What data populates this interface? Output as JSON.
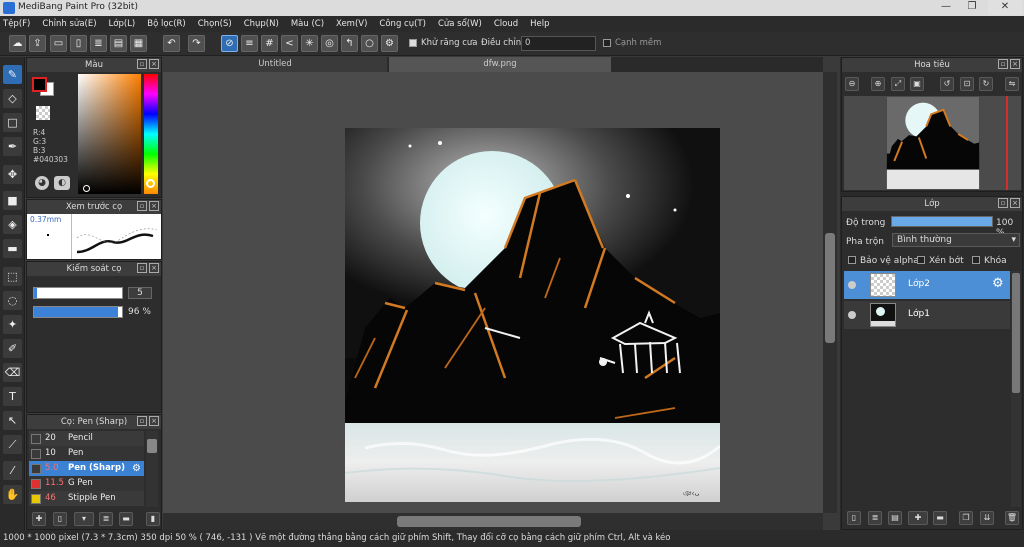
{
  "app": {
    "title": "MediBang Paint Pro (32bit)"
  },
  "menu": [
    "Tệp(F)",
    "Chỉnh sửa(E)",
    "Lớp(L)",
    "Bộ lọc(R)",
    "Chọn(S)",
    "Chụp(N)",
    "Màu (C)",
    "Xem(V)",
    "Công cụ(T)",
    "Cửa sổ(W)",
    "Cloud",
    "Help"
  ],
  "toolbar": {
    "antialias_label": "Khử răng cưa",
    "adjust_label": "Điều chỉnh",
    "adjust_value": "0",
    "snap_label": "Cạnh mềm"
  },
  "color_panel": {
    "title": "Màu",
    "r": "R:4",
    "g": "G:3",
    "b": "B:3",
    "hex": "#040303",
    "colors": {
      "primary": "#040303",
      "secondary": "#ffffff",
      "accent": "#2f6db5"
    }
  },
  "preview_panel": {
    "title": "Xem trước cọ",
    "size": "0.37mm"
  },
  "control_panel": {
    "title": "Kiểm soát cọ",
    "size_value": "5",
    "opacity_value": "96 %",
    "opacity_fraction": 0.96
  },
  "brush_panel": {
    "title": "Cọ: Pen (Sharp)",
    "items": [
      {
        "size": "20",
        "name": "Pencil",
        "color": "#3a3a3a",
        "selected": false
      },
      {
        "size": "10",
        "name": "Pen",
        "color": "#3a3a3a",
        "selected": false
      },
      {
        "size": "5.0",
        "name": "Pen (Sharp)",
        "color": "#3a3a3a",
        "selected": true
      },
      {
        "size": "11.5",
        "name": "G Pen",
        "color": "#e03030",
        "selected": false
      },
      {
        "size": "46",
        "name": "Stipple Pen",
        "color": "#e8c800",
        "selected": false
      }
    ]
  },
  "tabs": [
    {
      "label": "Untitled"
    },
    {
      "label": "dfw.png"
    }
  ],
  "navigator_panel": {
    "title": "Hoa tiêu"
  },
  "layers_panel": {
    "title": "Lớp",
    "opacity_label": "Độ trong",
    "opacity_value": "100 %",
    "opacity_fraction": 1.0,
    "blend_label": "Pha trộn",
    "blend_value": "Bình thường",
    "protect_alpha": "Bảo vệ alpha",
    "clipping": "Xén bớt",
    "lock": "Khóa",
    "layers": [
      {
        "name": "Lớp2",
        "selected": true
      },
      {
        "name": "Lớp1",
        "selected": false
      }
    ]
  },
  "status": {
    "text": "1000 * 1000 pixel   (7.3 * 7.3cm)  350 dpi   50 %   ( 746, -131 )  Vẽ một đường thẳng bằng cách giữ phím Shift, Thay đổi cỡ cọ bằng cách giữ phím Ctrl, Alt và kéo"
  }
}
